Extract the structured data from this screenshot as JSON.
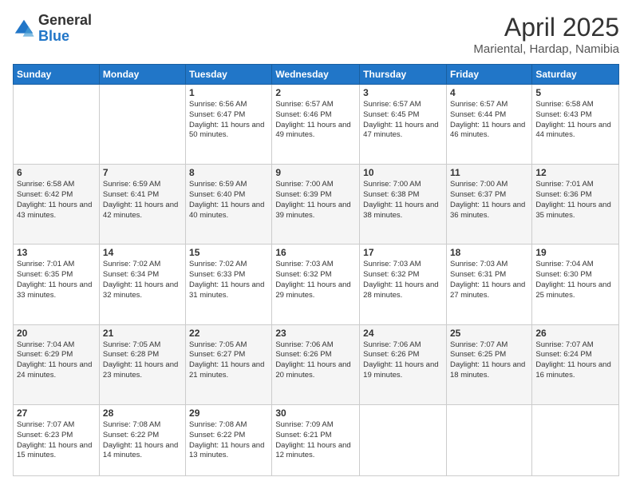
{
  "logo": {
    "general": "General",
    "blue": "Blue"
  },
  "header": {
    "title": "April 2025",
    "subtitle": "Mariental, Hardap, Namibia"
  },
  "weekdays": [
    "Sunday",
    "Monday",
    "Tuesday",
    "Wednesday",
    "Thursday",
    "Friday",
    "Saturday"
  ],
  "weeks": [
    [
      {
        "day": "",
        "sunrise": "",
        "sunset": "",
        "daylight": ""
      },
      {
        "day": "",
        "sunrise": "",
        "sunset": "",
        "daylight": ""
      },
      {
        "day": "1",
        "sunrise": "Sunrise: 6:56 AM",
        "sunset": "Sunset: 6:47 PM",
        "daylight": "Daylight: 11 hours and 50 minutes."
      },
      {
        "day": "2",
        "sunrise": "Sunrise: 6:57 AM",
        "sunset": "Sunset: 6:46 PM",
        "daylight": "Daylight: 11 hours and 49 minutes."
      },
      {
        "day": "3",
        "sunrise": "Sunrise: 6:57 AM",
        "sunset": "Sunset: 6:45 PM",
        "daylight": "Daylight: 11 hours and 47 minutes."
      },
      {
        "day": "4",
        "sunrise": "Sunrise: 6:57 AM",
        "sunset": "Sunset: 6:44 PM",
        "daylight": "Daylight: 11 hours and 46 minutes."
      },
      {
        "day": "5",
        "sunrise": "Sunrise: 6:58 AM",
        "sunset": "Sunset: 6:43 PM",
        "daylight": "Daylight: 11 hours and 44 minutes."
      }
    ],
    [
      {
        "day": "6",
        "sunrise": "Sunrise: 6:58 AM",
        "sunset": "Sunset: 6:42 PM",
        "daylight": "Daylight: 11 hours and 43 minutes."
      },
      {
        "day": "7",
        "sunrise": "Sunrise: 6:59 AM",
        "sunset": "Sunset: 6:41 PM",
        "daylight": "Daylight: 11 hours and 42 minutes."
      },
      {
        "day": "8",
        "sunrise": "Sunrise: 6:59 AM",
        "sunset": "Sunset: 6:40 PM",
        "daylight": "Daylight: 11 hours and 40 minutes."
      },
      {
        "day": "9",
        "sunrise": "Sunrise: 7:00 AM",
        "sunset": "Sunset: 6:39 PM",
        "daylight": "Daylight: 11 hours and 39 minutes."
      },
      {
        "day": "10",
        "sunrise": "Sunrise: 7:00 AM",
        "sunset": "Sunset: 6:38 PM",
        "daylight": "Daylight: 11 hours and 38 minutes."
      },
      {
        "day": "11",
        "sunrise": "Sunrise: 7:00 AM",
        "sunset": "Sunset: 6:37 PM",
        "daylight": "Daylight: 11 hours and 36 minutes."
      },
      {
        "day": "12",
        "sunrise": "Sunrise: 7:01 AM",
        "sunset": "Sunset: 6:36 PM",
        "daylight": "Daylight: 11 hours and 35 minutes."
      }
    ],
    [
      {
        "day": "13",
        "sunrise": "Sunrise: 7:01 AM",
        "sunset": "Sunset: 6:35 PM",
        "daylight": "Daylight: 11 hours and 33 minutes."
      },
      {
        "day": "14",
        "sunrise": "Sunrise: 7:02 AM",
        "sunset": "Sunset: 6:34 PM",
        "daylight": "Daylight: 11 hours and 32 minutes."
      },
      {
        "day": "15",
        "sunrise": "Sunrise: 7:02 AM",
        "sunset": "Sunset: 6:33 PM",
        "daylight": "Daylight: 11 hours and 31 minutes."
      },
      {
        "day": "16",
        "sunrise": "Sunrise: 7:03 AM",
        "sunset": "Sunset: 6:32 PM",
        "daylight": "Daylight: 11 hours and 29 minutes."
      },
      {
        "day": "17",
        "sunrise": "Sunrise: 7:03 AM",
        "sunset": "Sunset: 6:32 PM",
        "daylight": "Daylight: 11 hours and 28 minutes."
      },
      {
        "day": "18",
        "sunrise": "Sunrise: 7:03 AM",
        "sunset": "Sunset: 6:31 PM",
        "daylight": "Daylight: 11 hours and 27 minutes."
      },
      {
        "day": "19",
        "sunrise": "Sunrise: 7:04 AM",
        "sunset": "Sunset: 6:30 PM",
        "daylight": "Daylight: 11 hours and 25 minutes."
      }
    ],
    [
      {
        "day": "20",
        "sunrise": "Sunrise: 7:04 AM",
        "sunset": "Sunset: 6:29 PM",
        "daylight": "Daylight: 11 hours and 24 minutes."
      },
      {
        "day": "21",
        "sunrise": "Sunrise: 7:05 AM",
        "sunset": "Sunset: 6:28 PM",
        "daylight": "Daylight: 11 hours and 23 minutes."
      },
      {
        "day": "22",
        "sunrise": "Sunrise: 7:05 AM",
        "sunset": "Sunset: 6:27 PM",
        "daylight": "Daylight: 11 hours and 21 minutes."
      },
      {
        "day": "23",
        "sunrise": "Sunrise: 7:06 AM",
        "sunset": "Sunset: 6:26 PM",
        "daylight": "Daylight: 11 hours and 20 minutes."
      },
      {
        "day": "24",
        "sunrise": "Sunrise: 7:06 AM",
        "sunset": "Sunset: 6:26 PM",
        "daylight": "Daylight: 11 hours and 19 minutes."
      },
      {
        "day": "25",
        "sunrise": "Sunrise: 7:07 AM",
        "sunset": "Sunset: 6:25 PM",
        "daylight": "Daylight: 11 hours and 18 minutes."
      },
      {
        "day": "26",
        "sunrise": "Sunrise: 7:07 AM",
        "sunset": "Sunset: 6:24 PM",
        "daylight": "Daylight: 11 hours and 16 minutes."
      }
    ],
    [
      {
        "day": "27",
        "sunrise": "Sunrise: 7:07 AM",
        "sunset": "Sunset: 6:23 PM",
        "daylight": "Daylight: 11 hours and 15 minutes."
      },
      {
        "day": "28",
        "sunrise": "Sunrise: 7:08 AM",
        "sunset": "Sunset: 6:22 PM",
        "daylight": "Daylight: 11 hours and 14 minutes."
      },
      {
        "day": "29",
        "sunrise": "Sunrise: 7:08 AM",
        "sunset": "Sunset: 6:22 PM",
        "daylight": "Daylight: 11 hours and 13 minutes."
      },
      {
        "day": "30",
        "sunrise": "Sunrise: 7:09 AM",
        "sunset": "Sunset: 6:21 PM",
        "daylight": "Daylight: 11 hours and 12 minutes."
      },
      {
        "day": "",
        "sunrise": "",
        "sunset": "",
        "daylight": ""
      },
      {
        "day": "",
        "sunrise": "",
        "sunset": "",
        "daylight": ""
      },
      {
        "day": "",
        "sunrise": "",
        "sunset": "",
        "daylight": ""
      }
    ]
  ]
}
